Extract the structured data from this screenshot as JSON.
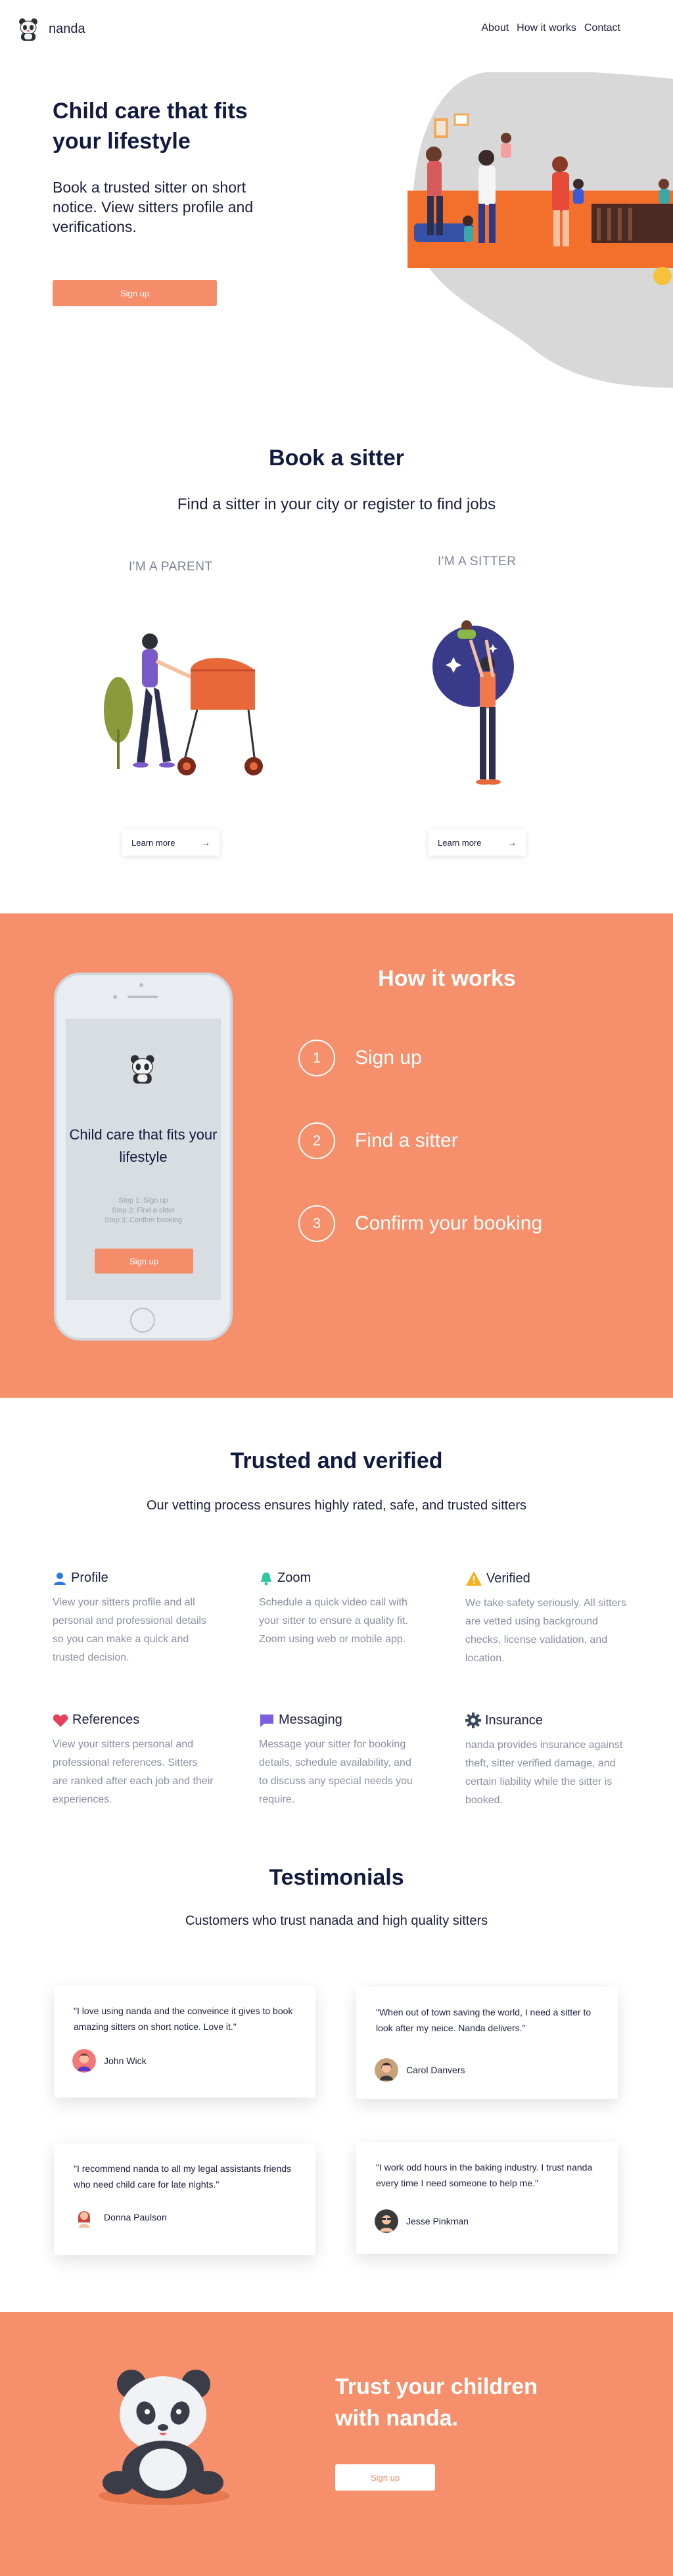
{
  "nav": {
    "brand": "nanda",
    "links": [
      "About",
      "How it works",
      "Contact"
    ]
  },
  "hero": {
    "title": "Child care that fits your lifestyle",
    "subtitle": "Book a trusted sitter on short notice. View sitters profile and verifications.",
    "cta": "Sign up"
  },
  "book": {
    "title": "Book a sitter",
    "subtitle": "Find a sitter in your city or register to find jobs",
    "parent_label": "I'M A PARENT",
    "sitter_label": "I'M A SITTER",
    "learn_more": "Learn more",
    "arrow": "→"
  },
  "how": {
    "title": "How it works",
    "steps": [
      {
        "num": "1",
        "label": "Sign up"
      },
      {
        "num": "2",
        "label": "Find a sitter"
      },
      {
        "num": "3",
        "label": "Confirm your booking"
      }
    ],
    "phone": {
      "title": "Child care that fits your lifestyle",
      "steps": [
        "Step 1: Sign up",
        "Step 2: Find a sitter",
        "Step 3: Confirm booking"
      ],
      "cta": "Sign up"
    }
  },
  "trusted": {
    "title": "Trusted and verified",
    "subtitle": "Our vetting process ensures highly rated, safe, and trusted sitters",
    "features": [
      {
        "title": "Profile",
        "icon": "person-icon",
        "color": "#2a7be4",
        "body": "View your sitters profile and all personal and professional details so you can make a quick and trusted decision."
      },
      {
        "title": "Zoom",
        "icon": "bell-icon",
        "color": "#2fc7a0",
        "body": "Schedule a quick video call with your sitter to ensure a quality fit. Zoom using web or mobile app."
      },
      {
        "title": "Verified",
        "icon": "warning-icon",
        "color": "#f3b31b",
        "body": "We take safety seriously. All sitters are vetted using background checks, license validation, and location."
      },
      {
        "title": "References",
        "icon": "heart-icon",
        "color": "#e8405c",
        "body": "View your sitters personal and professional references. Sitters are ranked after each job and their experiences."
      },
      {
        "title": "Messaging",
        "icon": "chat-icon",
        "color": "#7b5fe0",
        "body": "Message your sitter for booking details, schedule availability, and to discuss any special needs you require."
      },
      {
        "title": "Insurance",
        "icon": "gear-icon",
        "color": "#3d4a5c",
        "body": "nanda provides insurance against theft, sitter verified damage, and certain liability while the sitter is booked."
      }
    ]
  },
  "testimonials": {
    "title": "Testimonials",
    "subtitle": "Customers who trust nanada and high quality sitters",
    "items": [
      {
        "quote": "\"I love using nanda and the conveince it gives to book amazing sitters on short notice. Love it.\"",
        "name": "John Wick"
      },
      {
        "quote": "\"When out of town saving the world, I need a sitter to look after my neice. Nanda delivers.\"",
        "name": "Carol Danvers"
      },
      {
        "quote": "\"I recommend nanda to all my legal assistants friends who need child care for late nights.\"",
        "name": "Donna Paulson"
      },
      {
        "quote": "\"I work odd hours in the baking industry. I trust nanda every time I need someone to help me.\"",
        "name": "Jesse Pinkman"
      }
    ]
  },
  "cta": {
    "title": "Trust your children with nanda.",
    "button": "Sign up"
  },
  "colors": {
    "accent": "#f6906c",
    "navy": "#131a3f"
  }
}
